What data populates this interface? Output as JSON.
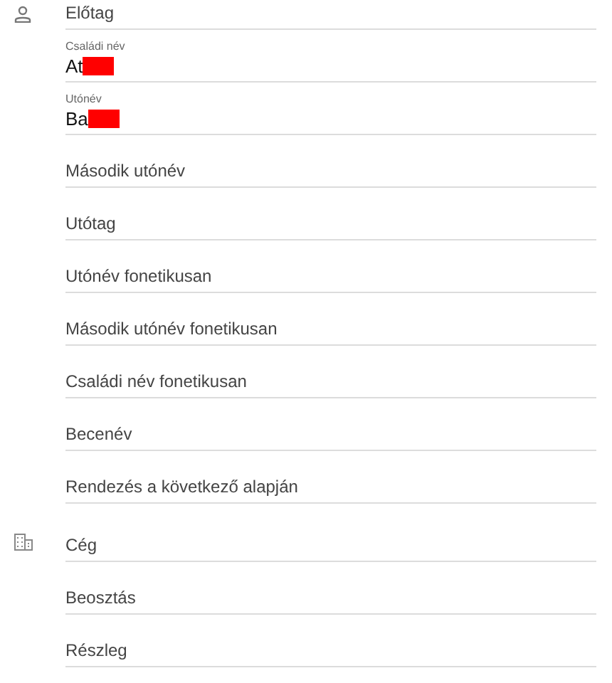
{
  "sections": [
    {
      "fields": [
        {
          "kind": "empty",
          "placeholder": "Előtag"
        },
        {
          "kind": "filled",
          "label": "Családi név",
          "value": "At",
          "redacted": true
        },
        {
          "kind": "filled",
          "label": "Utónév",
          "value": "Ba",
          "redacted": true
        },
        {
          "kind": "empty",
          "placeholder": "Második utónév"
        },
        {
          "kind": "empty",
          "placeholder": "Utótag"
        },
        {
          "kind": "empty",
          "placeholder": "Utónév fonetikusan"
        },
        {
          "kind": "empty",
          "placeholder": "Második utónév fonetikusan"
        },
        {
          "kind": "empty",
          "placeholder": "Családi név fonetikusan"
        },
        {
          "kind": "empty",
          "placeholder": "Becenév"
        },
        {
          "kind": "empty",
          "placeholder": "Rendezés a következő alapján"
        }
      ]
    },
    {
      "fields": [
        {
          "kind": "empty",
          "placeholder": "Cég"
        },
        {
          "kind": "empty",
          "placeholder": "Beosztás"
        },
        {
          "kind": "empty",
          "placeholder": "Részleg"
        }
      ]
    }
  ]
}
